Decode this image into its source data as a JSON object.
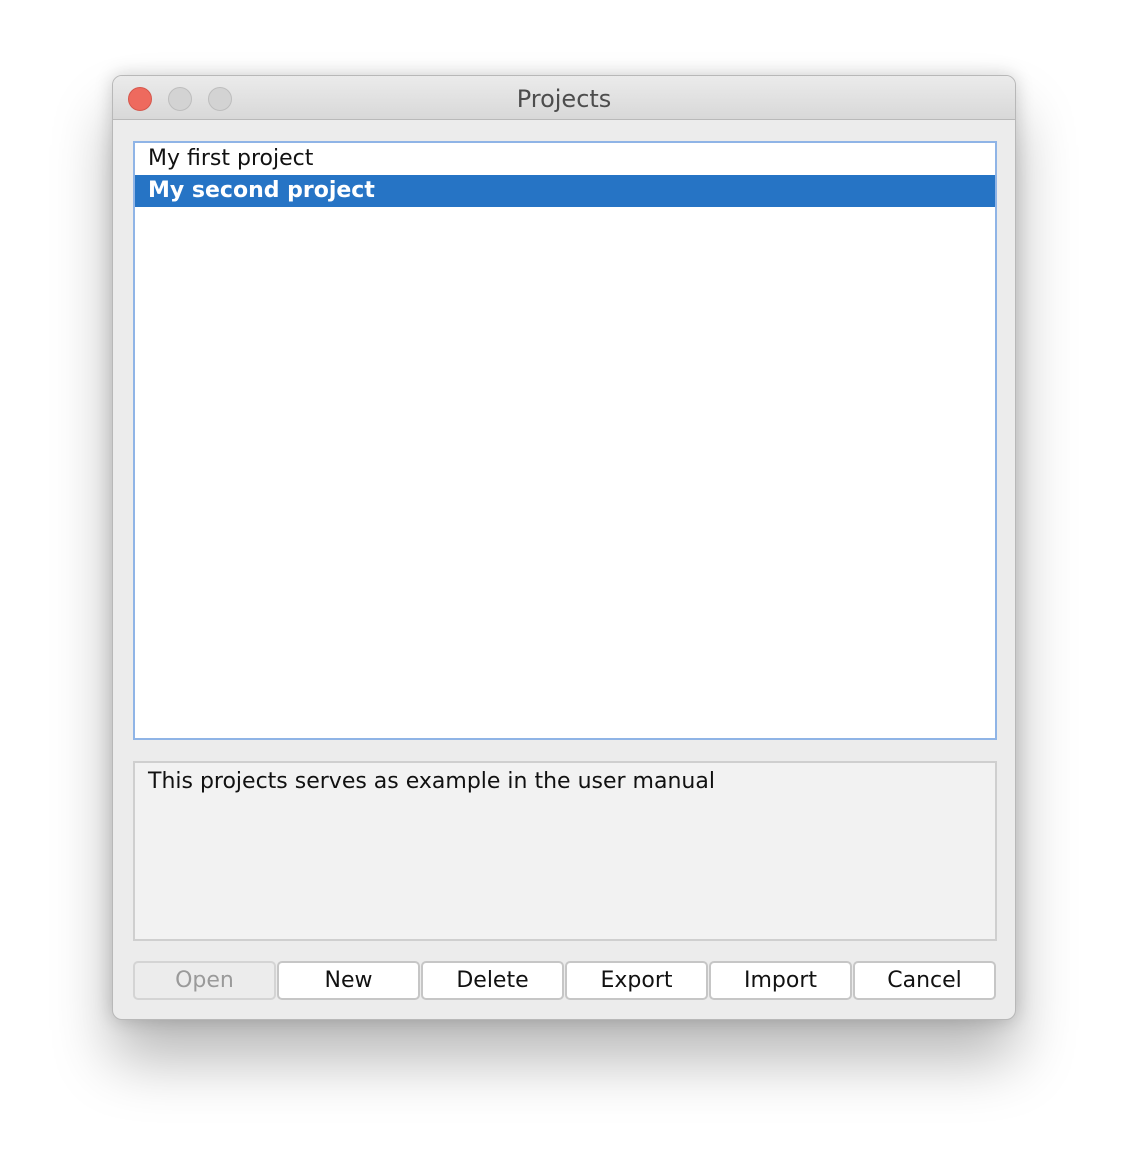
{
  "window": {
    "title": "Projects",
    "traffic_lights": {
      "close_color": "#ee6a5e",
      "minimize_color": "#d3d3d3",
      "maximize_color": "#d3d3d3"
    }
  },
  "projects": {
    "items": [
      {
        "label": "My first project",
        "selected": false
      },
      {
        "label": "My second project",
        "selected": true
      }
    ],
    "selection_color": "#2674c5"
  },
  "description": {
    "text": "This projects serves as example in the user manual"
  },
  "buttons": {
    "open": {
      "label": "Open",
      "enabled": false
    },
    "new": {
      "label": "New",
      "enabled": true
    },
    "delete": {
      "label": "Delete",
      "enabled": true
    },
    "export": {
      "label": "Export",
      "enabled": true
    },
    "import": {
      "label": "Import",
      "enabled": true
    },
    "cancel": {
      "label": "Cancel",
      "enabled": true
    }
  }
}
